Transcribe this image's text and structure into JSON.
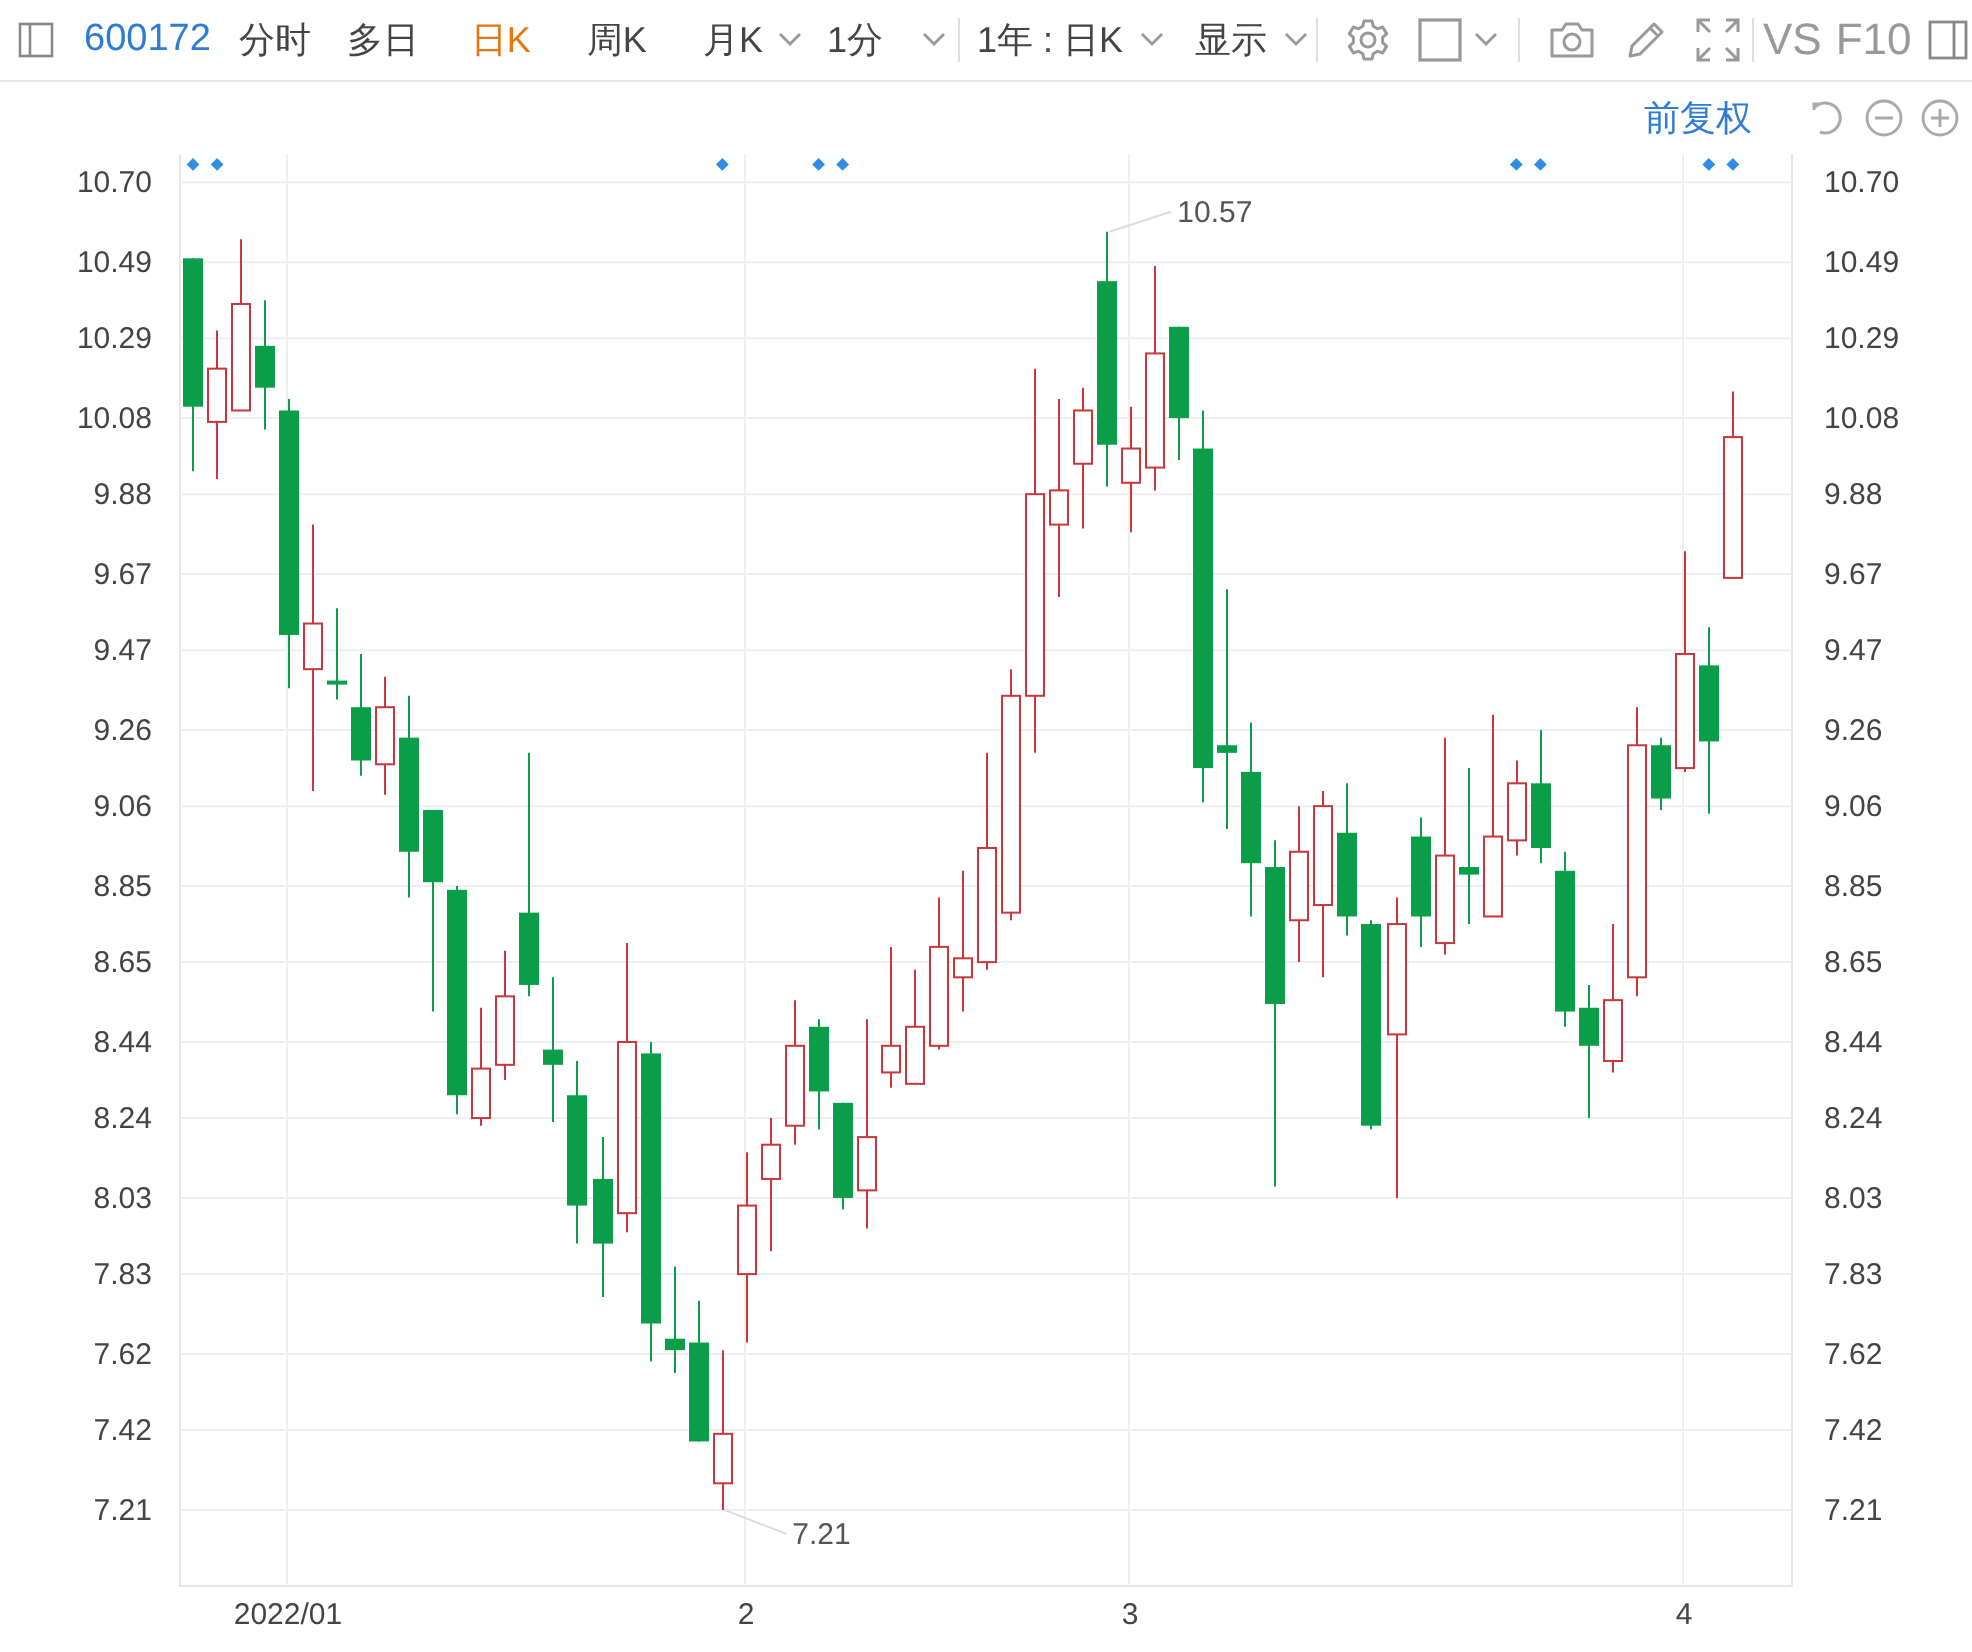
{
  "toolbar": {
    "symbol": "600172",
    "tabs": [
      {
        "label": "分时",
        "selected": false,
        "dropdown": false
      },
      {
        "label": "多日",
        "selected": false,
        "dropdown": false
      },
      {
        "label": "日K",
        "selected": true,
        "dropdown": false
      },
      {
        "label": "周K",
        "selected": false,
        "dropdown": false
      },
      {
        "label": "月K",
        "selected": false,
        "dropdown": true
      },
      {
        "label": "1分",
        "selected": false,
        "dropdown": true
      }
    ],
    "range": "1年 : 日K",
    "display": "显示",
    "compare": "VS",
    "f10": "F10"
  },
  "chart_controls": {
    "adjust": "前复权"
  },
  "chart": {
    "chart_data": {
      "type": "candlestick",
      "grid": true,
      "categories": [
        null,
        null,
        null,
        null,
        "2022/01",
        null,
        null,
        null,
        null,
        null,
        null,
        null,
        null,
        null,
        null,
        null,
        null,
        null,
        null,
        null,
        null,
        null,
        null,
        "2",
        null,
        null,
        null,
        null,
        null,
        null,
        null,
        null,
        null,
        null,
        null,
        null,
        null,
        null,
        null,
        "3",
        null,
        null,
        null,
        null,
        null,
        null,
        null,
        null,
        null,
        null,
        null,
        null,
        null,
        null,
        null,
        null,
        null,
        null,
        null,
        null,
        null,
        null,
        "4",
        null,
        null,
        null,
        null
      ],
      "ohlc": [
        [
          10.5,
          10.5,
          9.94,
          10.11
        ],
        [
          10.07,
          10.31,
          9.92,
          10.21
        ],
        [
          10.1,
          10.55,
          10.1,
          10.38
        ],
        [
          10.27,
          10.39,
          10.05,
          10.16
        ],
        [
          10.1,
          10.13,
          9.37,
          9.51
        ],
        [
          9.42,
          9.8,
          9.1,
          9.54
        ],
        [
          9.39,
          9.58,
          9.34,
          9.38
        ],
        [
          9.32,
          9.46,
          9.14,
          9.18
        ],
        [
          9.17,
          9.4,
          9.09,
          9.32
        ],
        [
          9.24,
          9.35,
          8.82,
          8.94
        ],
        [
          9.05,
          9.05,
          8.52,
          8.86
        ],
        [
          8.84,
          8.85,
          8.25,
          8.3
        ],
        [
          8.24,
          8.53,
          8.22,
          8.37
        ],
        [
          8.38,
          8.68,
          8.34,
          8.56
        ],
        [
          8.78,
          9.2,
          8.56,
          8.59
        ],
        [
          8.42,
          8.61,
          8.23,
          8.38
        ],
        [
          8.3,
          8.39,
          7.91,
          8.01
        ],
        [
          8.08,
          8.19,
          7.77,
          7.91
        ],
        [
          7.99,
          8.7,
          7.94,
          8.44
        ],
        [
          8.41,
          8.44,
          7.6,
          7.7
        ],
        [
          7.66,
          7.85,
          7.57,
          7.63
        ],
        [
          7.65,
          7.76,
          7.39,
          7.39
        ],
        [
          7.28,
          7.63,
          7.21,
          7.41
        ],
        [
          7.83,
          8.15,
          7.65,
          8.01
        ],
        [
          8.08,
          8.24,
          7.89,
          8.17
        ],
        [
          8.22,
          8.55,
          8.17,
          8.43
        ],
        [
          8.48,
          8.5,
          8.21,
          8.31
        ],
        [
          8.28,
          8.28,
          8.0,
          8.03
        ],
        [
          8.05,
          8.5,
          7.95,
          8.19
        ],
        [
          8.36,
          8.69,
          8.32,
          8.43
        ],
        [
          8.33,
          8.63,
          8.33,
          8.48
        ],
        [
          8.43,
          8.82,
          8.42,
          8.69
        ],
        [
          8.61,
          8.89,
          8.52,
          8.66
        ],
        [
          8.65,
          9.2,
          8.63,
          8.95
        ],
        [
          8.78,
          9.42,
          8.76,
          9.35
        ],
        [
          9.35,
          10.21,
          9.2,
          9.88
        ],
        [
          9.8,
          10.13,
          9.61,
          9.89
        ],
        [
          9.96,
          10.16,
          9.79,
          10.1
        ],
        [
          10.44,
          10.57,
          9.9,
          10.01
        ],
        [
          9.91,
          10.11,
          9.78,
          10.0
        ],
        [
          9.95,
          10.48,
          9.89,
          10.25
        ],
        [
          10.32,
          10.32,
          9.97,
          10.08
        ],
        [
          10.0,
          10.1,
          9.07,
          9.16
        ],
        [
          9.22,
          9.63,
          9.0,
          9.2
        ],
        [
          9.15,
          9.28,
          8.77,
          8.91
        ],
        [
          8.9,
          8.97,
          8.06,
          8.54
        ],
        [
          8.76,
          9.06,
          8.65,
          8.94
        ],
        [
          8.8,
          9.1,
          8.61,
          9.06
        ],
        [
          8.99,
          9.12,
          8.72,
          8.77
        ],
        [
          8.75,
          8.76,
          8.21,
          8.22
        ],
        [
          8.46,
          8.82,
          8.03,
          8.75
        ],
        [
          8.98,
          9.03,
          8.69,
          8.77
        ],
        [
          8.7,
          9.24,
          8.67,
          8.93
        ],
        [
          8.9,
          9.16,
          8.75,
          8.88
        ],
        [
          8.77,
          9.3,
          8.77,
          8.98
        ],
        [
          8.97,
          9.18,
          8.93,
          9.12
        ],
        [
          9.12,
          9.26,
          8.91,
          8.95
        ],
        [
          8.89,
          8.94,
          8.48,
          8.52
        ],
        [
          8.53,
          8.59,
          8.24,
          8.43
        ],
        [
          8.39,
          8.75,
          8.36,
          8.55
        ],
        [
          8.61,
          9.32,
          8.56,
          9.22
        ],
        [
          9.22,
          9.24,
          9.05,
          9.08
        ],
        [
          9.16,
          9.73,
          9.15,
          9.46
        ],
        [
          9.43,
          9.53,
          9.04,
          9.23
        ],
        [
          9.66,
          10.15,
          9.66,
          10.03
        ],
        null,
        null
      ],
      "ylim": [
        7.01,
        10.79
      ],
      "yticks": [
        {
          "value": 10.7,
          "label": "10.70"
        },
        {
          "value": 10.49,
          "label": "10.49"
        },
        {
          "value": 10.29,
          "label": "10.29"
        },
        {
          "value": 10.08,
          "label": "10.08"
        },
        {
          "value": 9.88,
          "label": "9.88"
        },
        {
          "value": 9.67,
          "label": "9.67"
        },
        {
          "value": 9.47,
          "label": "9.47"
        },
        {
          "value": 9.26,
          "label": "9.26"
        },
        {
          "value": 9.06,
          "label": "9.06"
        },
        {
          "value": 8.85,
          "label": "8.85"
        },
        {
          "value": 8.65,
          "label": "8.65"
        },
        {
          "value": 8.44,
          "label": "8.44"
        },
        {
          "value": 8.24,
          "label": "8.24"
        },
        {
          "value": 8.03,
          "label": "8.03"
        },
        {
          "value": 7.83,
          "label": "7.83"
        },
        {
          "value": 7.62,
          "label": "7.62"
        },
        {
          "value": 7.42,
          "label": "7.42"
        },
        {
          "value": 7.21,
          "label": "7.21"
        }
      ],
      "annotations": [
        "10.57",
        "7.21"
      ]
    },
    "event_markers": [
      true,
      true,
      false,
      false,
      false,
      false,
      false,
      false,
      false,
      false,
      false,
      false,
      false,
      false,
      false,
      false,
      false,
      false,
      false,
      false,
      false,
      false,
      true,
      false,
      false,
      false,
      true,
      true,
      false,
      false,
      false,
      false,
      false,
      false,
      false,
      false,
      false,
      false,
      false,
      false,
      false,
      false,
      false,
      false,
      false,
      false,
      false,
      false,
      false,
      false,
      false,
      false,
      false,
      false,
      false,
      true,
      true,
      false,
      false,
      false,
      false,
      false,
      false,
      true,
      true
    ]
  }
}
